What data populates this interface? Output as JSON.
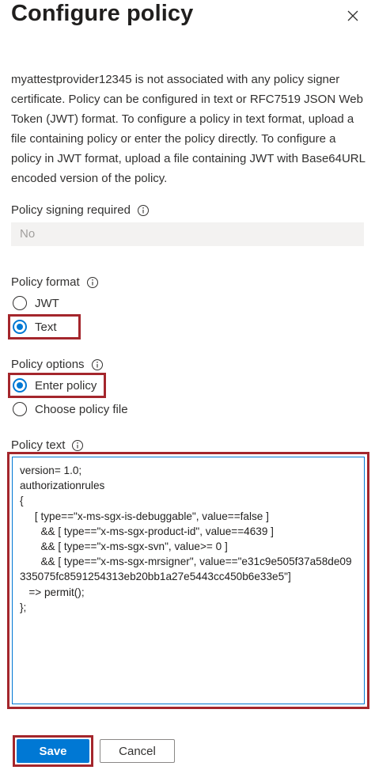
{
  "panel": {
    "title": "Configure policy",
    "close_icon": "close-icon"
  },
  "description": "myattestprovider12345 is not associated with any policy signer certificate. Policy can be configured in text or RFC7519 JSON Web Token (JWT) format. To configure a policy in text format, upload a file containing policy or enter the policy directly. To configure a policy in JWT format, upload a file containing JWT with Base64URL encoded version of the policy.",
  "signing_required": {
    "label": "Policy signing required",
    "value": "No"
  },
  "policy_format": {
    "label": "Policy format",
    "options": [
      "JWT",
      "Text"
    ],
    "selected": "Text"
  },
  "policy_options": {
    "label": "Policy options",
    "options": [
      "Enter policy",
      "Choose policy file"
    ],
    "selected": "Enter policy"
  },
  "policy_text": {
    "label": "Policy text",
    "value": "version= 1.0;\nauthorizationrules\n{\n     [ type==\"x-ms-sgx-is-debuggable\", value==false ]\n       && [ type==\"x-ms-sgx-product-id\", value==4639 ]\n       && [ type==\"x-ms-sgx-svn\", value>= 0 ]\n       && [ type==\"x-ms-sgx-mrsigner\", value==\"e31c9e505f37a58de09335075fc8591254313eb20bb1a27e5443cc450b6e33e5\"]\n   => permit();\n};"
  },
  "buttons": {
    "save": "Save",
    "cancel": "Cancel"
  },
  "colors": {
    "accent": "#0078d4",
    "highlight": "#a4262c",
    "disabled_bg": "#f3f2f1"
  }
}
